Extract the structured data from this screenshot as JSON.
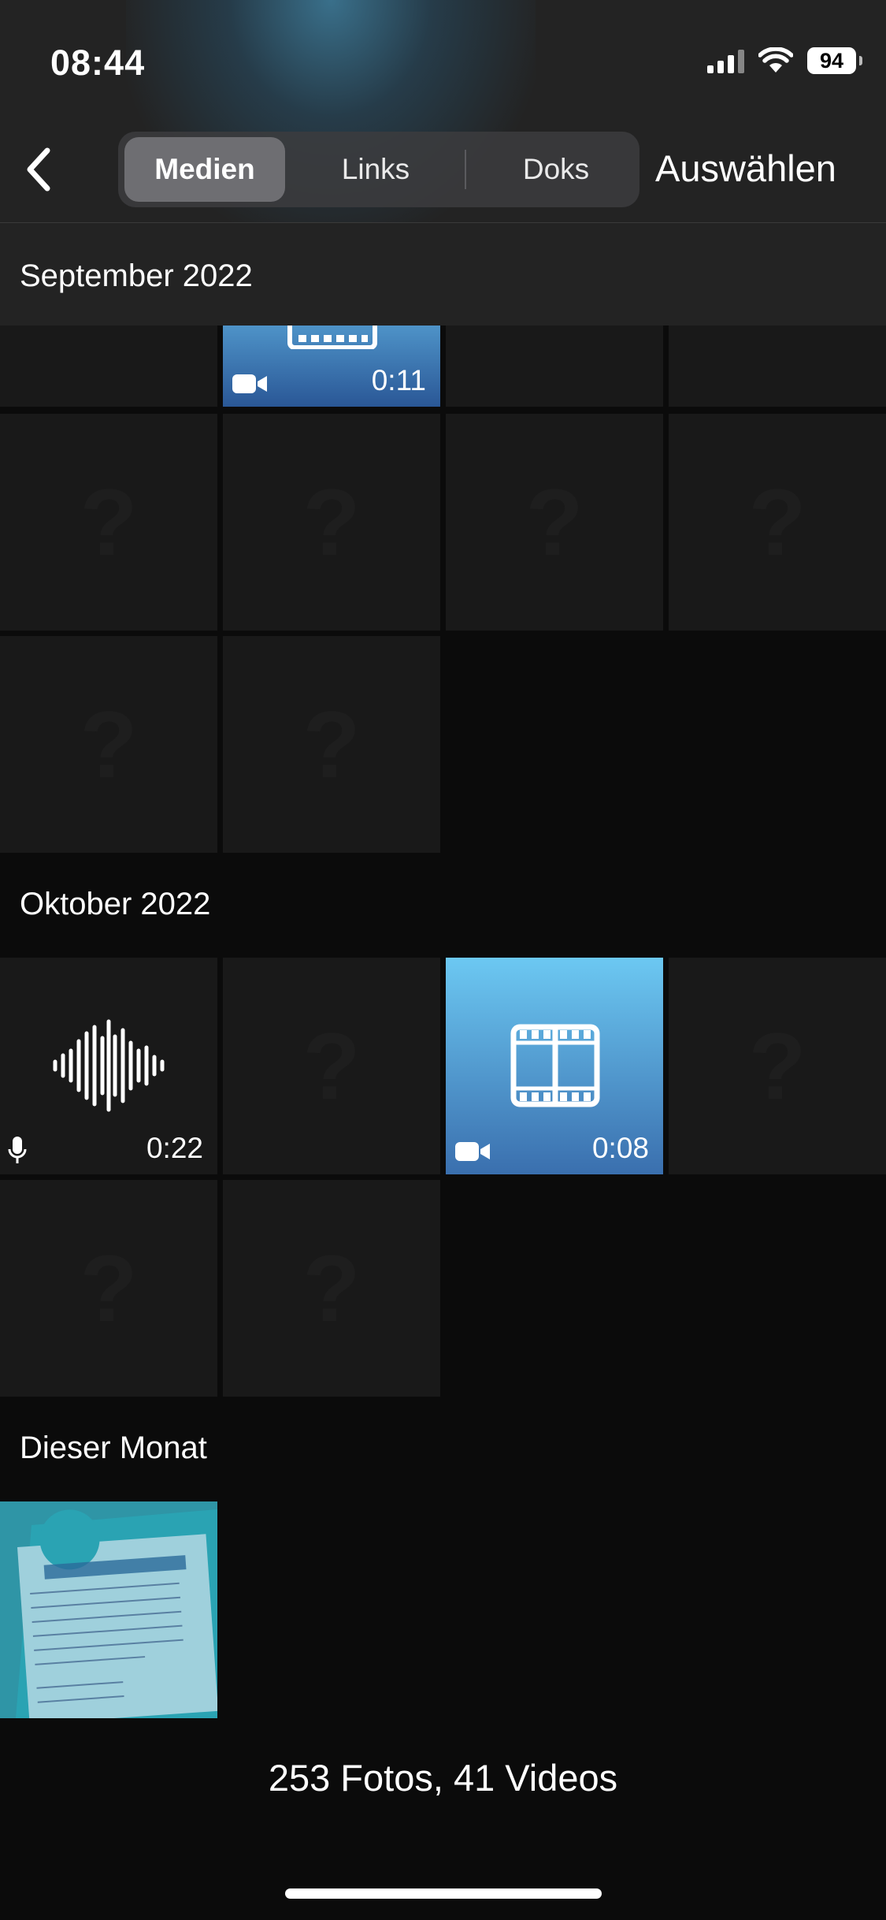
{
  "status_bar": {
    "time": "08:44",
    "battery": "94"
  },
  "nav": {
    "tabs": [
      {
        "label": "Medien"
      },
      {
        "label": "Links"
      },
      {
        "label": "Doks"
      }
    ],
    "select_label": "Auswählen"
  },
  "sections": [
    {
      "title": "September 2022",
      "video_duration": "0:11"
    },
    {
      "title": "Oktober 2022",
      "audio_duration": "0:22",
      "video_duration": "0:08"
    },
    {
      "title": "Dieser Monat"
    }
  ],
  "placeholder_glyph": "?",
  "footer": {
    "summary": "253 Fotos, 41 Videos"
  },
  "colors": {
    "accent_video_top": "#6cc8f2",
    "accent_video_bottom": "#3a6fae",
    "header_bg": "#232323",
    "background": "#0b0b0b"
  }
}
